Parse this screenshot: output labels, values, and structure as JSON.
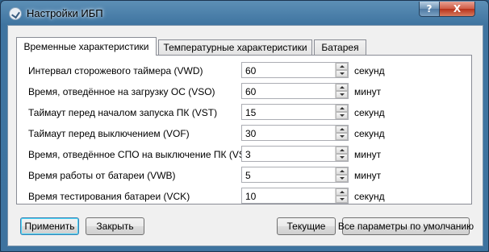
{
  "window": {
    "title": "Настройки ИБП",
    "help_label": "?",
    "close_label": "X"
  },
  "tabs": [
    {
      "label": "Временные характеристики",
      "active": true
    },
    {
      "label": "Температурные характеристики",
      "active": false
    },
    {
      "label": "Батарея",
      "active": false
    }
  ],
  "settings": [
    {
      "label": "Интервал сторожевого таймера (VWD)",
      "value": "60",
      "unit": "секунд"
    },
    {
      "label": "Время, отведённое на загрузку ОС (VSO)",
      "value": "60",
      "unit": "минут"
    },
    {
      "label": "Таймаут перед началом запуска ПК (VST)",
      "value": "15",
      "unit": "секунд"
    },
    {
      "label": "Таймаут перед выключением (VOF)",
      "value": "30",
      "unit": "секунд"
    },
    {
      "label": "Время, отведённое СПО на выключение ПК (VSD)",
      "value": "3",
      "unit": "минут"
    },
    {
      "label": "Время работы от батареи (VWB)",
      "value": "5",
      "unit": "минут"
    },
    {
      "label": "Время тестирования батареи (VCK)",
      "value": "10",
      "unit": "секунд"
    }
  ],
  "buttons": {
    "apply": "Применить",
    "close": "Закрыть",
    "current": "Текущие",
    "defaults": "Все параметры по умолчанию"
  }
}
